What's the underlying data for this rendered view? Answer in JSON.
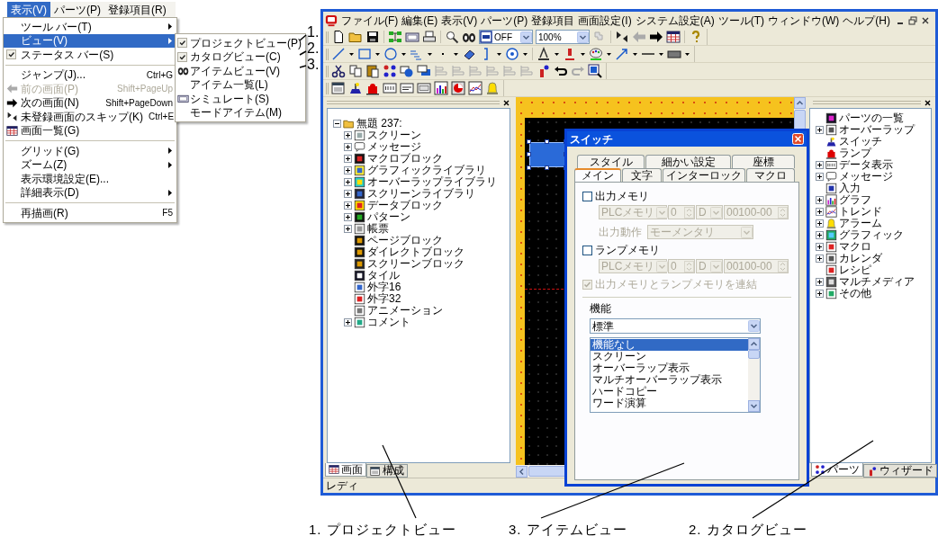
{
  "view_menu": {
    "menubar": [
      {
        "label": "表示(V)",
        "selected": true
      },
      {
        "label": "パーツ(P)",
        "selected": false
      },
      {
        "label": "登録項目(R)",
        "selected": false
      }
    ],
    "items": [
      {
        "kind": "item",
        "label": "ツール バー(T)",
        "submenu": true,
        "checked": false,
        "disabled": false,
        "selected": false
      },
      {
        "kind": "item",
        "label": "ビュー(V)",
        "submenu": true,
        "checked": false,
        "disabled": false,
        "selected": true
      },
      {
        "kind": "item",
        "label": "ステータス バー(S)",
        "submenu": false,
        "checked": true,
        "disabled": false,
        "selected": false
      },
      {
        "kind": "separator"
      },
      {
        "kind": "item",
        "label": "ジャンプ(J)...",
        "shortcut": "Ctrl+G",
        "submenu": false,
        "checked": false,
        "disabled": false,
        "selected": false
      },
      {
        "kind": "item",
        "label": "前の画面(P)",
        "shortcut": "Shift+PageUp",
        "submenu": false,
        "checked": false,
        "disabled": true,
        "selected": false
      },
      {
        "kind": "item",
        "label": "次の画面(N)",
        "shortcut": "Shift+PageDown",
        "submenu": false,
        "checked": false,
        "disabled": false,
        "selected": false
      },
      {
        "kind": "item",
        "label": "未登録画面のスキップ(K)",
        "shortcut": "Ctrl+E",
        "submenu": false,
        "checked": false,
        "disabled": false,
        "selected": false
      },
      {
        "kind": "item",
        "label": "画面一覧(G)",
        "submenu": false,
        "checked": false,
        "disabled": false,
        "selected": false
      },
      {
        "kind": "separator"
      },
      {
        "kind": "item",
        "label": "グリッド(G)",
        "submenu": true,
        "checked": false,
        "disabled": false,
        "selected": false
      },
      {
        "kind": "item",
        "label": "ズーム(Z)",
        "submenu": true,
        "checked": false,
        "disabled": false,
        "selected": false
      },
      {
        "kind": "item",
        "label": "表示環境設定(E)...",
        "submenu": false,
        "checked": false,
        "disabled": false,
        "selected": false
      },
      {
        "kind": "item",
        "label": "詳細表示(D)",
        "submenu": true,
        "checked": false,
        "disabled": false,
        "selected": false
      },
      {
        "kind": "separator"
      },
      {
        "kind": "item",
        "label": "再描画(R)",
        "shortcut": "F5",
        "submenu": false,
        "checked": false,
        "disabled": false,
        "selected": false
      }
    ],
    "view_submenu": [
      {
        "label": "プロジェクトビュー(P)",
        "checked": true
      },
      {
        "label": "カタログビュー(C)",
        "checked": true
      },
      {
        "label": "アイテムビュー(V)",
        "checked": false
      },
      {
        "label": "アイテム一覧(L)",
        "checked": false
      },
      {
        "label": "シミュレート(S)",
        "checked": false
      },
      {
        "label": "モードアイテム(M)",
        "checked": false
      }
    ]
  },
  "callout_numbers": [
    "1.",
    "2.",
    "3."
  ],
  "app": {
    "menubar": [
      "ファイル(F)",
      "編集(E)",
      "表示(V)",
      "パーツ(P)",
      "登録項目",
      "画面設定(I)",
      "システム設定(A)",
      "ツール(T)",
      "ウィンドウ(W)",
      "ヘルプ(H)"
    ],
    "mode_combo": "OFF",
    "zoom_combo": "100%",
    "project_view": {
      "root": {
        "label": "無題 237:",
        "expanded": true,
        "children": [
          {
            "label": "スクリーン",
            "kind": "folder"
          },
          {
            "label": "メッセージ",
            "kind": "folder"
          },
          {
            "label": "マクロブロック",
            "kind": "folder"
          },
          {
            "label": "グラフィックライブラリ",
            "kind": "folder"
          },
          {
            "label": "オーバーラップライブラリ",
            "kind": "folder"
          },
          {
            "label": "スクリーンライブラリ",
            "kind": "folder"
          },
          {
            "label": "データブロック",
            "kind": "folder"
          },
          {
            "label": "パターン",
            "kind": "folder"
          },
          {
            "label": "帳票",
            "kind": "folder"
          },
          {
            "label": "ページブロック",
            "kind": "leaf"
          },
          {
            "label": "ダイレクトブロック",
            "kind": "leaf"
          },
          {
            "label": "スクリーンブロック",
            "kind": "leaf"
          },
          {
            "label": "タイル",
            "kind": "leaf"
          },
          {
            "label": "外字16",
            "kind": "leaf"
          },
          {
            "label": "外字32",
            "kind": "leaf"
          },
          {
            "label": "アニメーション",
            "kind": "leaf"
          },
          {
            "label": "コメント",
            "kind": "folder"
          }
        ]
      },
      "tabs": [
        {
          "label": "画面",
          "selected": true
        },
        {
          "label": "構成",
          "selected": false
        }
      ]
    },
    "dialog": {
      "title": "スイッチ",
      "tab_rows": [
        {
          "tabs": [
            {
              "label": "スタイル",
              "selected": false
            },
            {
              "label": "細かい設定",
              "selected": false
            },
            {
              "label": "座標",
              "selected": false
            }
          ]
        },
        {
          "tabs": [
            {
              "label": "メイン",
              "selected": true
            },
            {
              "label": "文字",
              "selected": false
            },
            {
              "label": "インターロック",
              "selected": false
            },
            {
              "label": "マクロ",
              "selected": false
            }
          ]
        }
      ],
      "output_memory": {
        "label": "出力メモリ",
        "checked": false
      },
      "output_memory_fields": {
        "device": "PLCメモリ",
        "station": "0",
        "type": "D",
        "address": "00100-00",
        "disabled": true
      },
      "output_action": {
        "label": "出力動作",
        "value": "モーメンタリ",
        "disabled": true
      },
      "lamp_memory": {
        "label": "ランプメモリ",
        "checked": false
      },
      "lamp_memory_fields": {
        "device": "PLCメモリ",
        "station": "0",
        "type": "D",
        "address": "00100-00",
        "disabled": true
      },
      "link": {
        "label": "出力メモリとランプメモリを連結",
        "checked": true,
        "disabled": true
      },
      "function": {
        "label": "機能",
        "value": "標準",
        "options": [
          {
            "label": "機能なし",
            "selected": true
          },
          {
            "label": "スクリーン",
            "selected": false
          },
          {
            "label": "オーバーラップ表示",
            "selected": false
          },
          {
            "label": "マルチオーバーラップ表示",
            "selected": false
          },
          {
            "label": "ハードコピー",
            "selected": false
          },
          {
            "label": "ワード演算",
            "selected": false
          }
        ]
      }
    },
    "catalog_view": {
      "items": [
        {
          "label": "パーツの一覧",
          "kind": "leaf"
        },
        {
          "label": "オーバーラップ",
          "kind": "folder"
        },
        {
          "label": "スイッチ",
          "kind": "leaf"
        },
        {
          "label": "ランプ",
          "kind": "leaf"
        },
        {
          "label": "データ表示",
          "kind": "folder"
        },
        {
          "label": "メッセージ",
          "kind": "folder"
        },
        {
          "label": "入力",
          "kind": "leaf"
        },
        {
          "label": "グラフ",
          "kind": "folder"
        },
        {
          "label": "トレンド",
          "kind": "folder"
        },
        {
          "label": "アラーム",
          "kind": "folder"
        },
        {
          "label": "グラフィック",
          "kind": "folder"
        },
        {
          "label": "マクロ",
          "kind": "folder"
        },
        {
          "label": "カレンダ",
          "kind": "folder"
        },
        {
          "label": "レシピ",
          "kind": "leaf"
        },
        {
          "label": "マルチメディア",
          "kind": "folder"
        },
        {
          "label": "その他",
          "kind": "folder"
        }
      ],
      "tabs": [
        {
          "label": "パーツ",
          "selected": true
        },
        {
          "label": "ウィザード",
          "selected": false
        }
      ]
    },
    "status_bar": "レディ"
  },
  "callout_labels": [
    "1. プロジェクトビュー",
    "3. アイテムビュー",
    "2. カタログビュー"
  ]
}
